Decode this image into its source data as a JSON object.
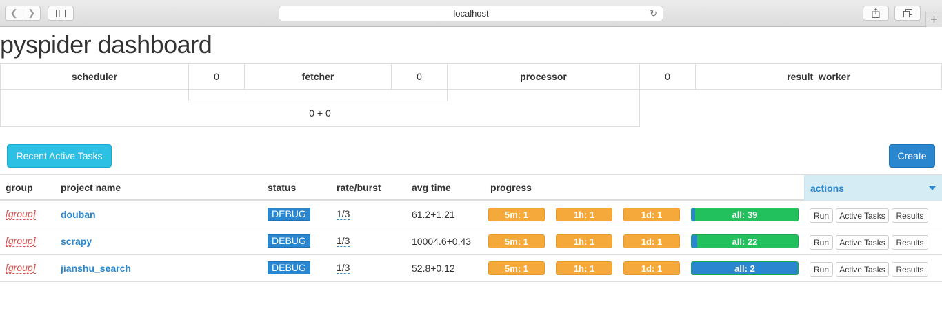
{
  "browser": {
    "url": "localhost",
    "back_icon": "chevron-left-icon",
    "forward_icon": "chevron-right-icon",
    "sidebar_icon": "sidebar-icon",
    "reload_icon": "reload-icon",
    "share_icon": "share-icon",
    "tabs_icon": "tabs-icon",
    "newtab_icon": "plus-icon"
  },
  "page_title": "pyspider dashboard",
  "queues": {
    "scheduler_label": "scheduler",
    "scheduler_to_fetcher": "0",
    "fetcher_label": "fetcher",
    "fetcher_to_processor": "0",
    "processor_label": "processor",
    "processor_to_result": "0",
    "result_worker_label": "result_worker",
    "scheduler_in": "0 + 0"
  },
  "buttons": {
    "recent_active_tasks": "Recent Active Tasks",
    "create": "Create"
  },
  "table": {
    "headers": {
      "group": "group",
      "project_name": "project name",
      "status": "status",
      "rate_burst": "rate/burst",
      "avg_time": "avg time",
      "progress": "progress",
      "actions": "actions"
    },
    "rows": [
      {
        "group": "[group]",
        "name": "douban",
        "status": "DEBUG",
        "rate": "1/3",
        "avg": "61.2+1.21",
        "p5m": "5m: 1",
        "p1h": "1h: 1",
        "p1d": "1d: 1",
        "pall": "all: 39",
        "pall_blue_fraction": 0.03,
        "run": "Run",
        "active_tasks": "Active Tasks",
        "results": "Results"
      },
      {
        "group": "[group]",
        "name": "scrapy",
        "status": "DEBUG",
        "rate": "1/3",
        "avg": "10004.6+0.43",
        "p5m": "5m: 1",
        "p1h": "1h: 1",
        "p1d": "1d: 1",
        "pall": "all: 22",
        "pall_blue_fraction": 0.05,
        "run": "Run",
        "active_tasks": "Active Tasks",
        "results": "Results"
      },
      {
        "group": "[group]",
        "name": "jianshu_search",
        "status": "DEBUG",
        "rate": "1/3",
        "avg": "52.8+0.12",
        "p5m": "5m: 1",
        "p1h": "1h: 1",
        "p1d": "1d: 1",
        "pall": "all: 2",
        "pall_blue_fraction": 1.0,
        "run": "Run",
        "active_tasks": "Active Tasks",
        "results": "Results"
      }
    ]
  },
  "colors": {
    "primary": "#2a87cf",
    "info": "#2bc0e4",
    "warning": "#f6a93b",
    "success": "#22c15e",
    "danger": "#d9534f"
  }
}
